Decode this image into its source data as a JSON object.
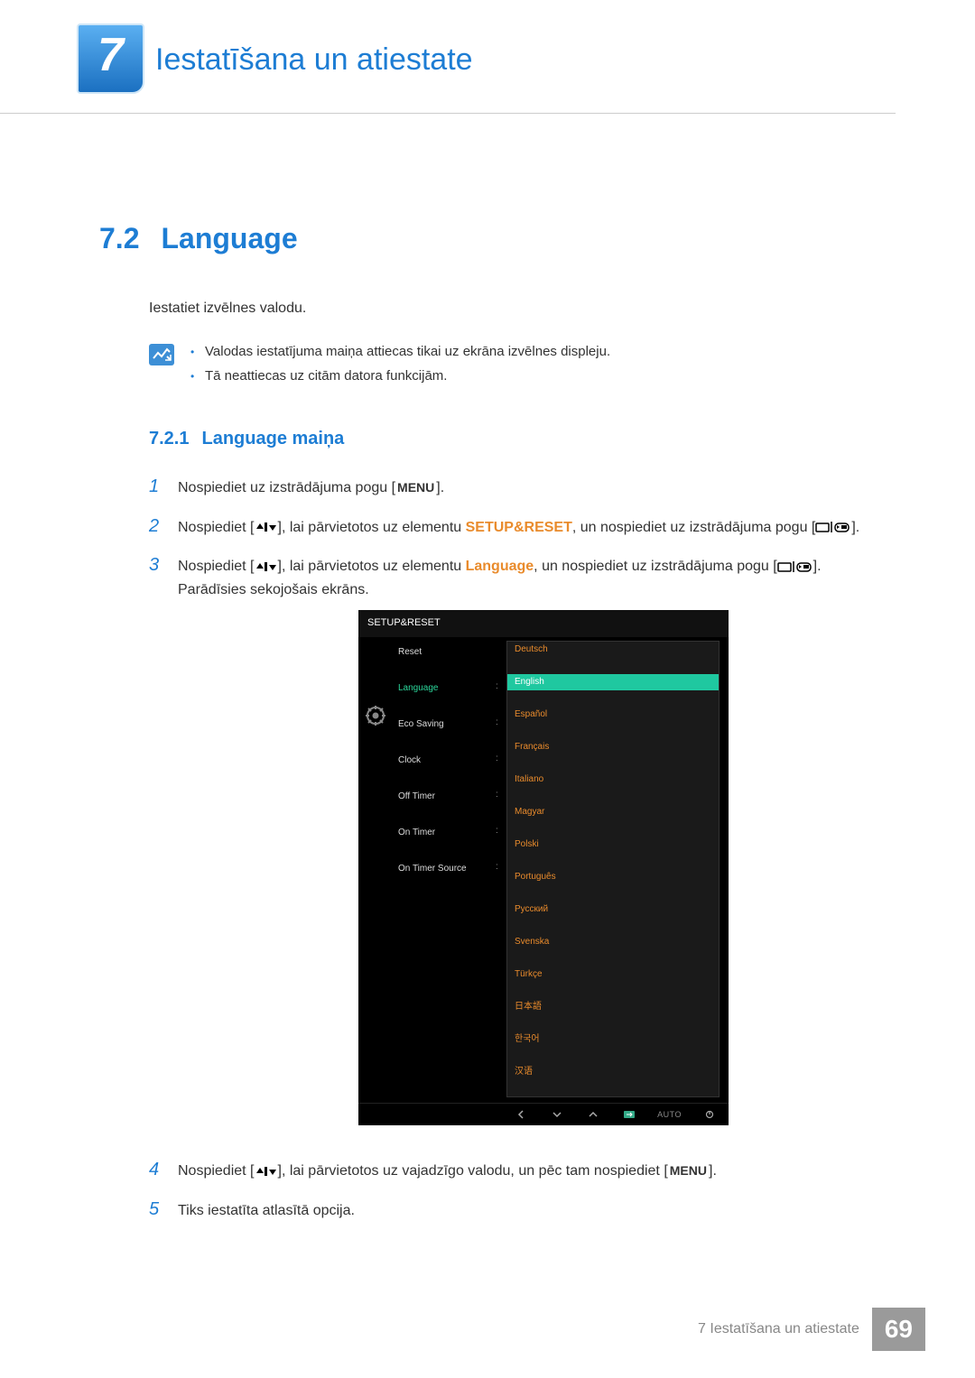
{
  "header": {
    "chapter_number": "7",
    "chapter_title": "Iestatīšana un atiestate"
  },
  "section": {
    "number": "7.2",
    "title": "Language",
    "intro": "Iestatiet izvēlnes valodu.",
    "notes": [
      "Valodas iestatījuma maiņa attiecas tikai uz ekrāna izvēlnes displeju.",
      "Tā neattiecas uz citām datora funkcijām."
    ]
  },
  "subsection": {
    "number": "7.2.1",
    "title": "Language maiņa"
  },
  "steps": {
    "s1_pre": "Nospiediet uz izstrādājuma pogu [",
    "s1_menu": "MENU",
    "s1_post": "].",
    "s2_pre": "Nospiediet [",
    "s2_mid": "], lai pārvietotos uz elementu ",
    "s2_bold": "SETUP&RESET",
    "s2_post1": ", un nospiediet uz izstrādājuma pogu [",
    "s2_post2": "].",
    "s3_pre": "Nospiediet [",
    "s3_mid": "], lai pārvietotos uz elementu ",
    "s3_bold": "Language",
    "s3_post1": ", un nospiediet uz izstrādājuma pogu [",
    "s3_post2": "]. Parādīsies sekojošais ekrāns.",
    "s4_pre": "Nospiediet [",
    "s4_mid": "], lai pārvietotos uz vajadzīgo valodu, un pēc tam nospiediet [",
    "s4_menu": "MENU",
    "s4_post": "].",
    "s5": "Tiks iestatīta atlasītā opcija."
  },
  "osd": {
    "title": "SETUP&RESET",
    "menu": [
      "Reset",
      "Language",
      "Eco Saving",
      "Clock",
      "Off Timer",
      "On Timer",
      "On Timer Source"
    ],
    "selected_menu_index": 1,
    "languages": [
      "Deutsch",
      "English",
      "Español",
      "Français",
      "Italiano",
      "Magyar",
      "Polski",
      "Português",
      "Русский",
      "Svenska",
      "Türkçe",
      "日本語",
      "한국어",
      "汉语"
    ],
    "highlight_index": 1,
    "auto_label": "AUTO"
  },
  "footer": {
    "text": "7 Iestatīšana un atiestate",
    "page": "69"
  }
}
